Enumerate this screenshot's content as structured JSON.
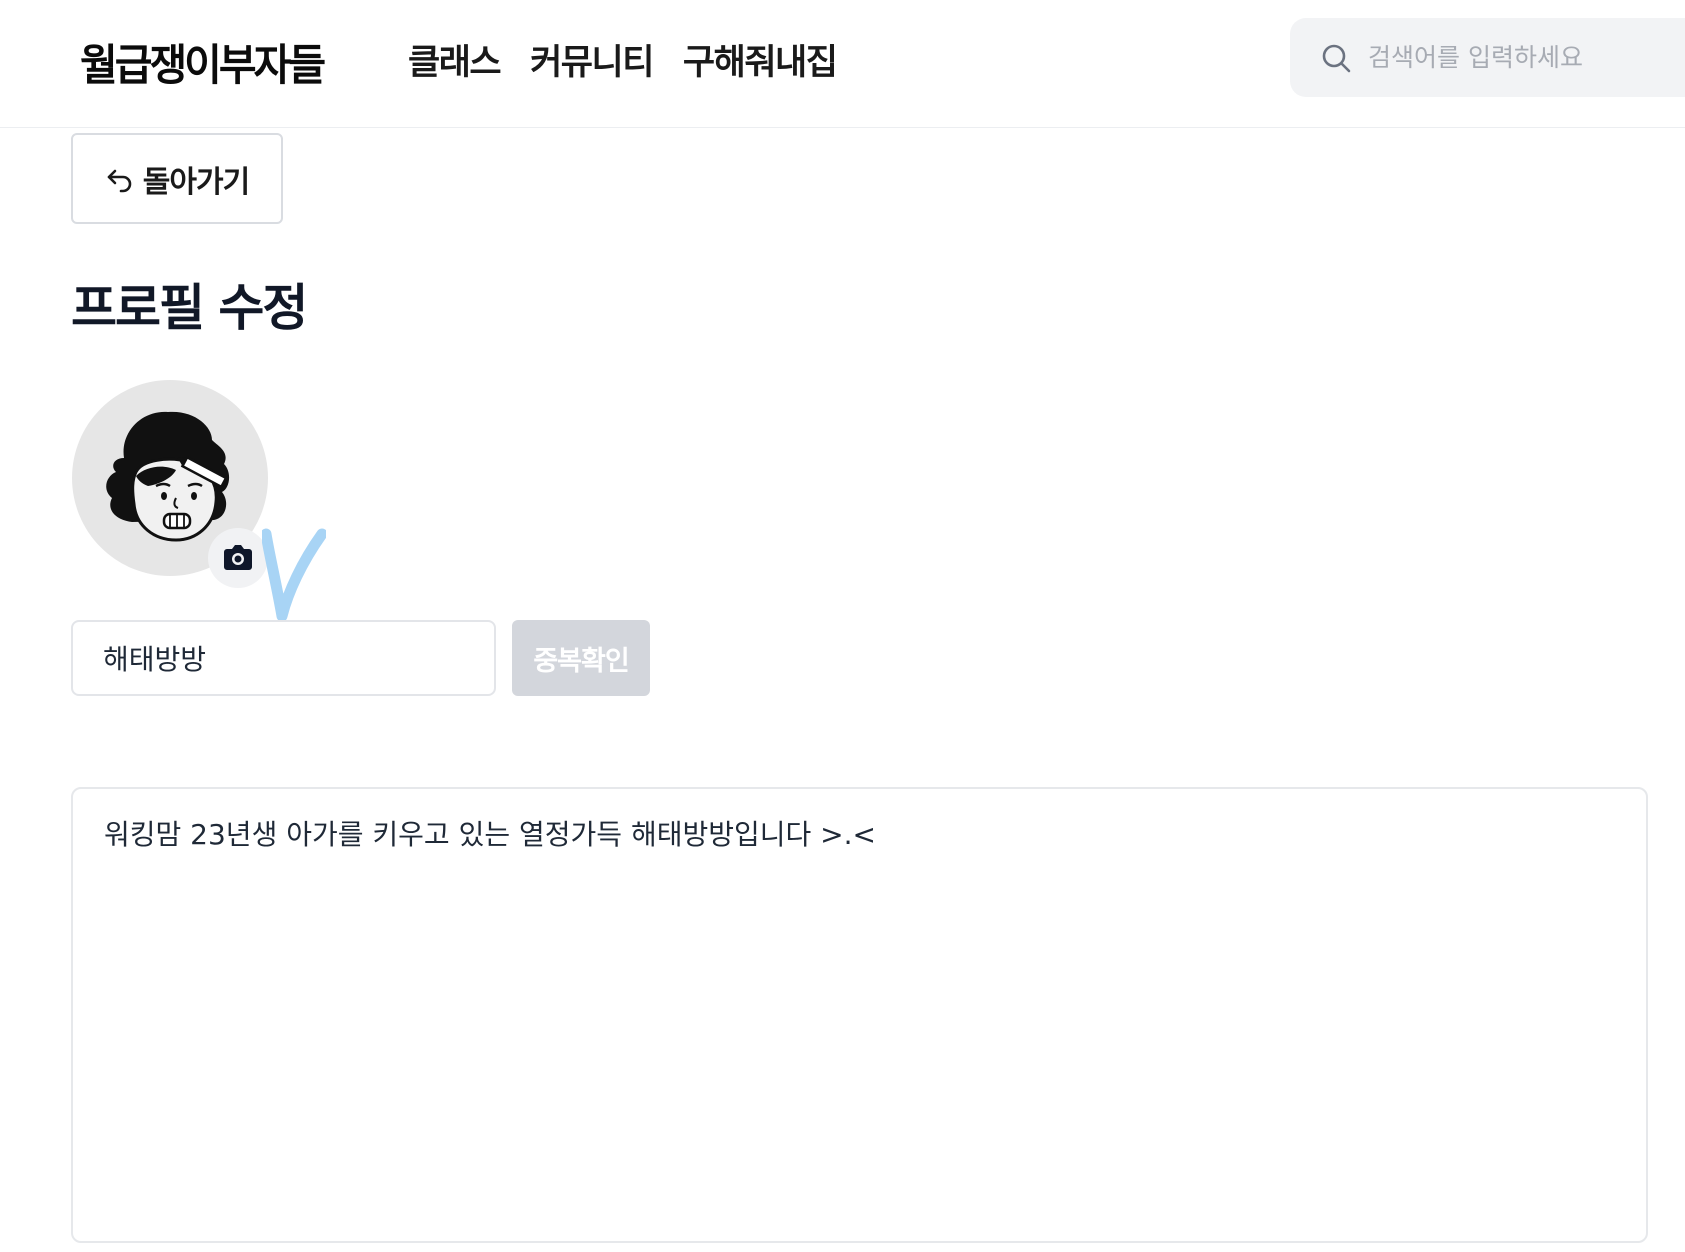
{
  "header": {
    "logo": "월급쟁이부자들",
    "nav": [
      {
        "label": "클래스"
      },
      {
        "label": "커뮤니티"
      },
      {
        "label": "구해줘내집"
      }
    ],
    "search": {
      "placeholder": "검색어를 입력하세요",
      "icon": "search-icon"
    }
  },
  "back_button": {
    "label": "돌아가기",
    "icon": "back-arrow-icon"
  },
  "page_title": "프로필 수정",
  "profile": {
    "avatar_icon": "cartoon-avatar",
    "camera_icon": "camera-icon",
    "nickname": {
      "value": "해태방방"
    },
    "duplicate_check_label": "중복확인",
    "bio": {
      "value": "워킹맘 23년생 아가를 키우고 있는 열정가득 해태방방입니다 >.<"
    }
  },
  "colors": {
    "text_dark": "#111827",
    "search_bg": "#f2f3f5",
    "disabled_button": "#d3d6dc",
    "border": "#e3e5e9",
    "check_mark": "#a8d4f5"
  }
}
